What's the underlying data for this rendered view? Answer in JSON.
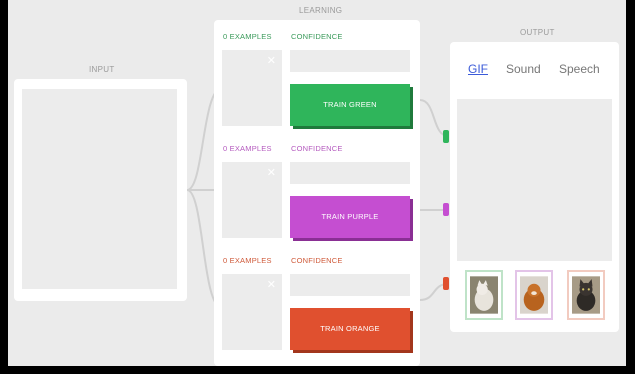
{
  "sections": {
    "input_title": "INPUT",
    "learning_title": "LEARNING",
    "output_title": "OUTPUT"
  },
  "classes": [
    {
      "examples_label": "0 EXAMPLES",
      "confidence_label": "CONFIDENCE",
      "train_label": "TRAIN GREEN",
      "color": "#2fb55b",
      "label_color": "#3a9a5a",
      "shadow": "#1f7a3c",
      "close_icon": "close-icon"
    },
    {
      "examples_label": "0 EXAMPLES",
      "confidence_label": "CONFIDENCE",
      "train_label": "TRAIN PURPLE",
      "color": "#c54ed1",
      "label_color": "#b55bbf",
      "shadow": "#8a2f94",
      "close_icon": "close-icon"
    },
    {
      "examples_label": "0 EXAMPLES",
      "confidence_label": "CONFIDENCE",
      "train_label": "TRAIN ORANGE",
      "color": "#e0502f",
      "label_color": "#cf5a3a",
      "shadow": "#a3361c",
      "close_icon": "close-icon"
    }
  ],
  "output": {
    "tabs": [
      "GIF",
      "Sound",
      "Speech"
    ],
    "active_tab": "GIF",
    "thumbnails": [
      {
        "name": "cat-gif-thumbnail",
        "border": "#bfe3c8"
      },
      {
        "name": "dog-gif-thumbnail",
        "border": "#e3c4e8"
      },
      {
        "name": "cat-gif-thumbnail-2",
        "border": "#f2cbc0"
      }
    ]
  }
}
